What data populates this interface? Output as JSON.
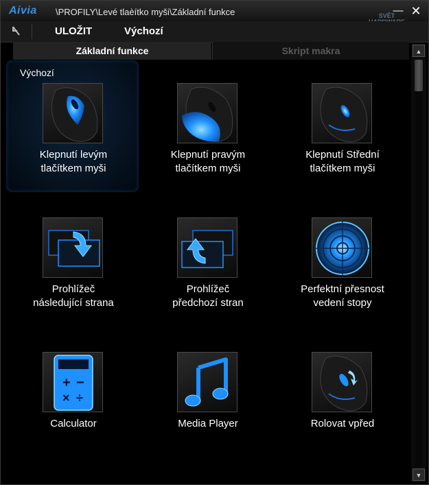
{
  "window": {
    "logo": "Aivia",
    "path": "\\PROFILY\\Levé tlaèítko myši\\Základní funkce",
    "watermark_top": "SVĚT",
    "watermark_bottom": "HARDWARE"
  },
  "toolbar": {
    "save_label": "ULOŽIT",
    "default_label": "Výchozí"
  },
  "tabs": [
    {
      "label": "Základní funkce",
      "active": true
    },
    {
      "label": "Skript makra",
      "active": false
    }
  ],
  "group_label": "Výchozí",
  "tiles": [
    {
      "line1": "Klepnutí levým",
      "line2": "tlačítkem myši",
      "icon": "mouse-left-click-icon",
      "selected": true
    },
    {
      "line1": "Klepnutí pravým",
      "line2": "tlačítkem myši",
      "icon": "mouse-right-click-icon"
    },
    {
      "line1": "Klepnutí Střední",
      "line2": "tlačítkem myši",
      "icon": "mouse-middle-click-icon"
    },
    {
      "line1": "Prohlížeč",
      "line2": "následující strana",
      "icon": "browser-forward-icon"
    },
    {
      "line1": "Prohlížeč",
      "line2": "předchozí stran",
      "icon": "browser-back-icon"
    },
    {
      "line1": "Perfektní přesnost",
      "line2": "vedení stopy",
      "icon": "precision-target-icon"
    },
    {
      "line1": "Calculator",
      "line2": "",
      "icon": "calculator-icon"
    },
    {
      "line1": "Media Player",
      "line2": "",
      "icon": "music-note-icon"
    },
    {
      "line1": "Rolovat vpřed",
      "line2": "",
      "icon": "scroll-forward-icon"
    }
  ],
  "colors": {
    "accent": "#1e90ff",
    "glow": "#5cc8ff"
  }
}
